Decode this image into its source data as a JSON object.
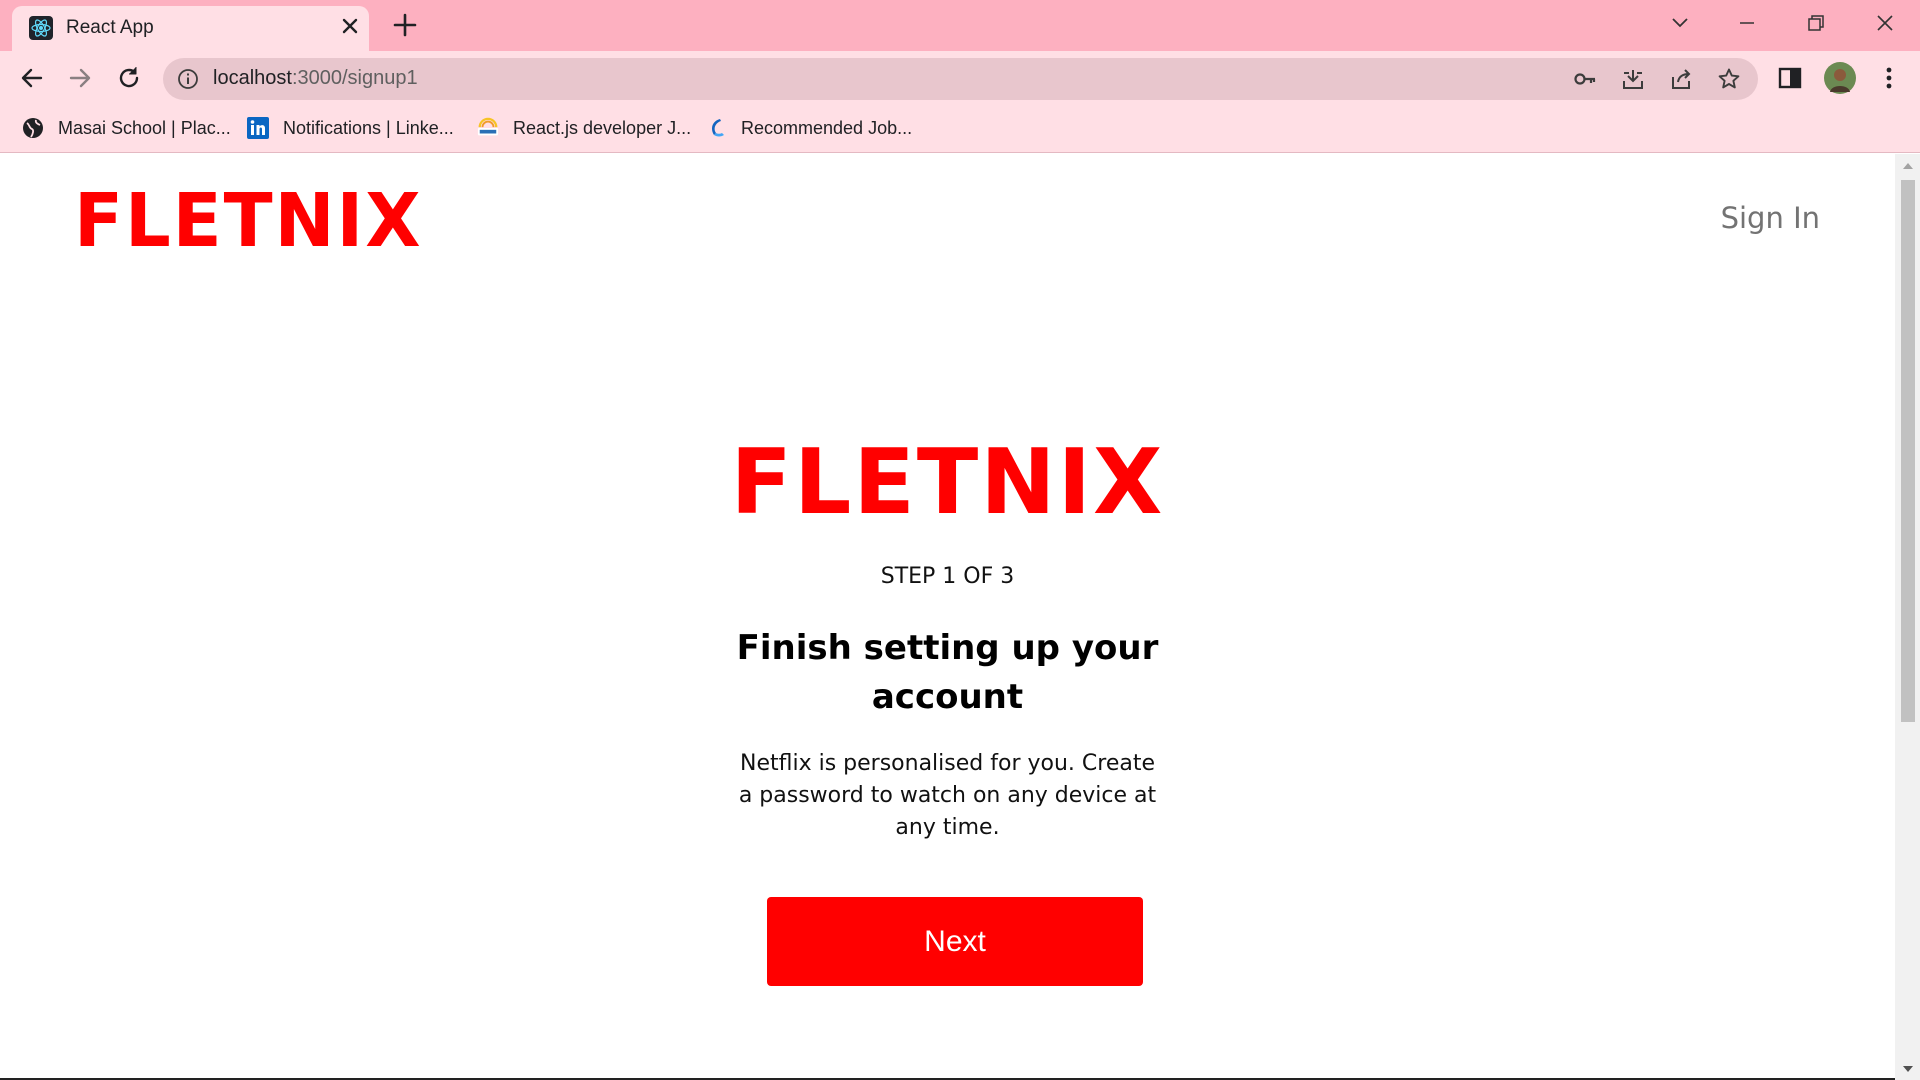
{
  "browser": {
    "tab": {
      "title": "React App"
    },
    "address": {
      "host": "localhost",
      "path": ":3000/signup1"
    },
    "bookmarks": [
      {
        "label": "Masai School | Plac...",
        "icon": "globe-icon"
      },
      {
        "label": "Notifications | Linke...",
        "icon": "linkedin-icon"
      },
      {
        "label": "React.js developer J...",
        "icon": "shine-icon"
      },
      {
        "label": "Recommended Job...",
        "icon": "job-site-icon"
      }
    ]
  },
  "header": {
    "logo": "FLETNIX",
    "sign_in": "Sign In"
  },
  "signup": {
    "logo": "FLETNIX",
    "step": "STEP 1 OF 3",
    "heading": "Finish setting up your account",
    "description": "Netflix is personalised for you. Create a password to watch on any device at any time.",
    "next_label": "Next"
  },
  "colors": {
    "brand": "#ff0000",
    "chrome_titlebar": "#fdb0c0",
    "chrome_toolbar": "#ffdfe5"
  }
}
